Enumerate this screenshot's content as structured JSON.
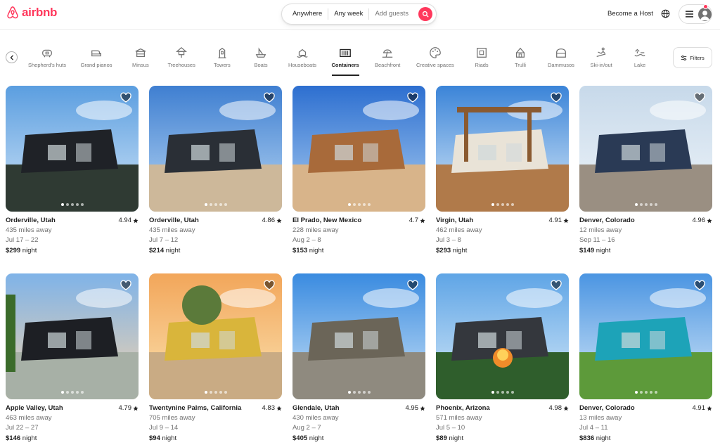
{
  "header": {
    "logo_text": "airbnb",
    "search": {
      "where": "Anywhere",
      "when": "Any week",
      "guests": "Add guests"
    },
    "become_host": "Become a Host"
  },
  "categories": [
    {
      "label": "Shepherd's huts",
      "icon": "hut-icon"
    },
    {
      "label": "Grand pianos",
      "icon": "piano-icon"
    },
    {
      "label": "Minsus",
      "icon": "minsu-icon"
    },
    {
      "label": "Treehouses",
      "icon": "treehouse-icon"
    },
    {
      "label": "Towers",
      "icon": "tower-icon"
    },
    {
      "label": "Boats",
      "icon": "boat-icon"
    },
    {
      "label": "Houseboats",
      "icon": "houseboat-icon"
    },
    {
      "label": "Containers",
      "icon": "container-icon",
      "active": true
    },
    {
      "label": "Beachfront",
      "icon": "beach-icon"
    },
    {
      "label": "Creative spaces",
      "icon": "palette-icon"
    },
    {
      "label": "Riads",
      "icon": "riad-icon"
    },
    {
      "label": "Trulli",
      "icon": "trullo-icon"
    },
    {
      "label": "Dammusos",
      "icon": "dammuso-icon"
    },
    {
      "label": "Ski-in/out",
      "icon": "ski-icon"
    },
    {
      "label": "Lake",
      "icon": "lake-icon"
    }
  ],
  "filters_label": "Filters",
  "colors": {
    "brand": "#FF385C",
    "text": "#222222",
    "muted": "#717171",
    "border": "#dddddd"
  },
  "listings": [
    {
      "location": "Orderville, Utah",
      "rating": "4.94",
      "distance": "435 miles away",
      "dates": "Jul 17 – 22",
      "price": "$299",
      "price_unit": "night"
    },
    {
      "location": "Orderville, Utah",
      "rating": "4.86",
      "distance": "435 miles away",
      "dates": "Jul 7 – 12",
      "price": "$214",
      "price_unit": "night"
    },
    {
      "location": "El Prado, New Mexico",
      "rating": "4.7",
      "distance": "228 miles away",
      "dates": "Aug 2 – 8",
      "price": "$153",
      "price_unit": "night"
    },
    {
      "location": "Virgin, Utah",
      "rating": "4.91",
      "distance": "462 miles away",
      "dates": "Jul 3 – 8",
      "price": "$293",
      "price_unit": "night"
    },
    {
      "location": "Denver, Colorado",
      "rating": "4.96",
      "distance": "12 miles away",
      "dates": "Sep 11 – 16",
      "price": "$149",
      "price_unit": "night"
    },
    {
      "location": "Apple Valley, Utah",
      "rating": "4.79",
      "distance": "463 miles away",
      "dates": "Jul 22 – 27",
      "price": "$146",
      "price_unit": "night"
    },
    {
      "location": "Twentynine Palms, California",
      "rating": "4.83",
      "distance": "705 miles away",
      "dates": "Jul 9 – 14",
      "price": "$94",
      "price_unit": "night"
    },
    {
      "location": "Glendale, Utah",
      "rating": "4.95",
      "distance": "430 miles away",
      "dates": "Aug 2 – 7",
      "price": "$405",
      "price_unit": "night"
    },
    {
      "location": "Phoenix, Arizona",
      "rating": "4.98",
      "distance": "571 miles away",
      "dates": "Jul 5 – 10",
      "price": "$89",
      "price_unit": "night"
    },
    {
      "location": "Denver, Colorado",
      "rating": "4.91",
      "distance": "13 miles away",
      "dates": "Jul 4 – 11",
      "price": "$836",
      "price_unit": "night"
    }
  ]
}
